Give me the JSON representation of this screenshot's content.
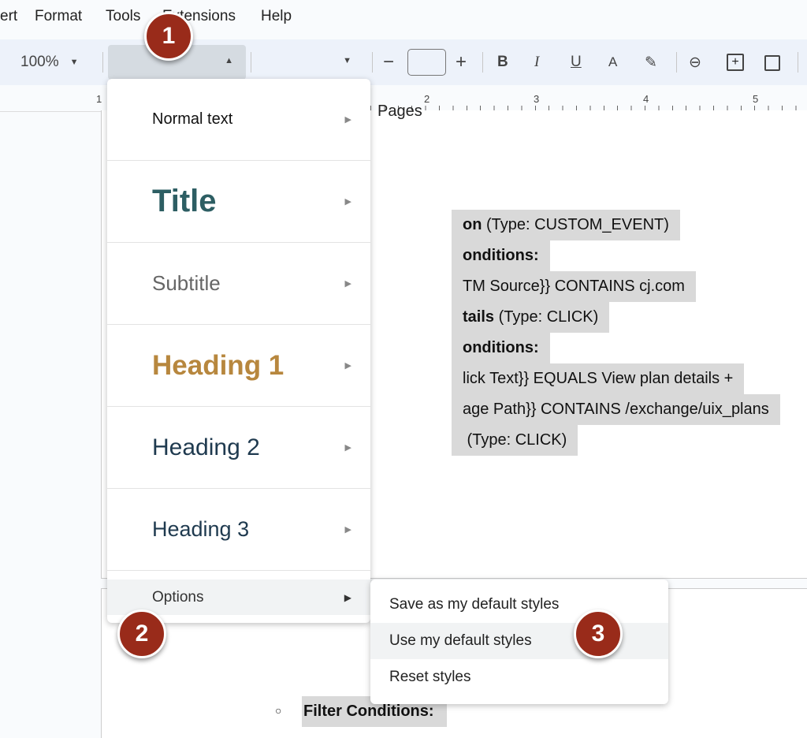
{
  "menubar": {
    "items": [
      "ert",
      "Format",
      "Tools",
      "Extensions",
      "Help"
    ]
  },
  "toolbar": {
    "zoom": "100%",
    "font_size": "",
    "minus": "−",
    "plus": "+",
    "bold": "B",
    "italic": "I",
    "underline": "U",
    "text_color": "A"
  },
  "ruler": {
    "ticks": [
      "1",
      "2",
      "3",
      "4",
      "5"
    ]
  },
  "document": {
    "partial_heading": "Pages",
    "lines": [
      {
        "bold": "on",
        "rest": " (Type: CUSTOM_EVENT)"
      },
      {
        "bold": "onditions:",
        "rest": ""
      },
      {
        "bold": "",
        "rest": "TM Source}} CONTAINS cj.com"
      },
      {
        "bold": "tails",
        "rest": " (Type: CLICK)"
      },
      {
        "bold": "onditions:",
        "rest": ""
      },
      {
        "bold": "",
        "rest": "lick Text}} EQUALS View plan details +"
      },
      {
        "bold": "",
        "rest": "age Path}} CONTAINS /exchange/uix_plans"
      },
      {
        "bold": "",
        "rest": " (Type: CLICK)"
      }
    ],
    "page2_line": "Filter Conditions:"
  },
  "style_menu": {
    "items": [
      "Normal text",
      "Title",
      "Subtitle",
      "Heading 1",
      "Heading 2",
      "Heading 3"
    ],
    "options": "Options"
  },
  "submenu": {
    "items": [
      "Save as my default styles",
      "Use my default styles",
      "Reset styles"
    ],
    "highlighted": "Use my default styles"
  },
  "badges": [
    "1",
    "2",
    "3"
  ],
  "colors": {
    "title": "#2d5e63",
    "heading1": "#b7873e",
    "heading": "#1f3a4f",
    "badge": "#992b1a",
    "highlight": "#d9d9d9"
  }
}
